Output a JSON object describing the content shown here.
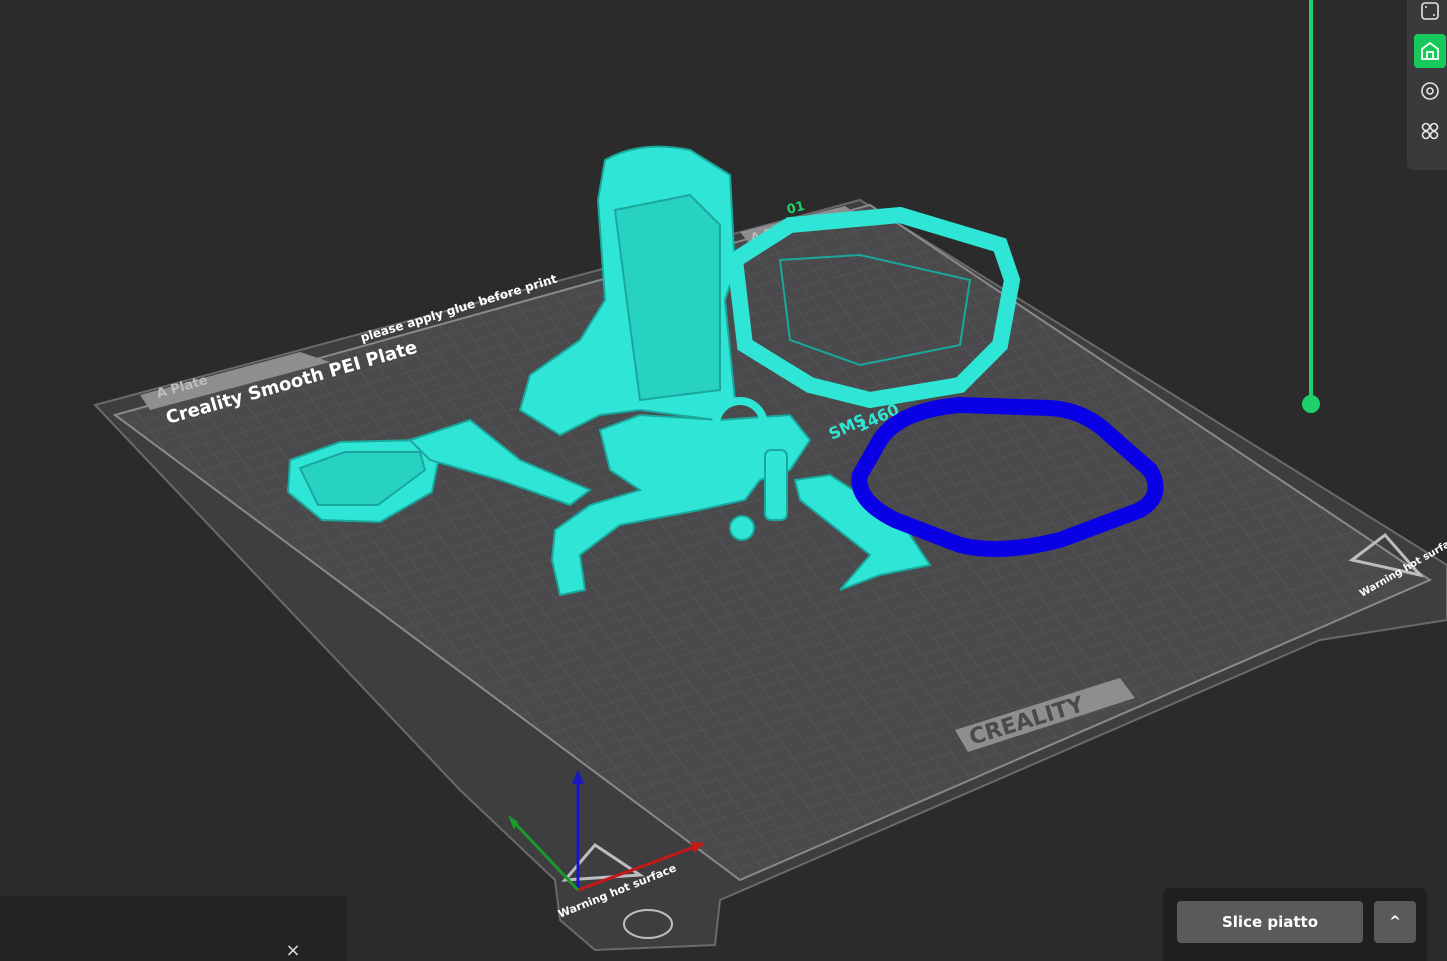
{
  "bed": {
    "brand_logo": "CREALITY",
    "plate_name": "Creality Smooth PEI Plate",
    "plate_note": "please apply glue before print",
    "plate_tab_left": "A Plate",
    "plate_tab_right": "A Plate",
    "plate_number": "01",
    "warning_text": "Warning hot surface",
    "warning_text_right": "Warning hot surface"
  },
  "model_text": {
    "embossed_1": "SMS",
    "embossed_2": "1460"
  },
  "slice": {
    "button_label": "Slice piatto",
    "more_label": "^"
  },
  "panel": {
    "close_label": "×"
  },
  "colors": {
    "background": "#2b2b2c",
    "bed": "#4a4a4c",
    "grid": "#5e5e61",
    "model_cyan": "#2fe6d6",
    "model_selected": "#0a00e6",
    "accent_green": "#1fd06a"
  },
  "toolbar": {
    "icons": [
      "layout-icon",
      "overhang-icon",
      "camera-target-icon",
      "arrange-icon"
    ],
    "active_index": 1
  }
}
